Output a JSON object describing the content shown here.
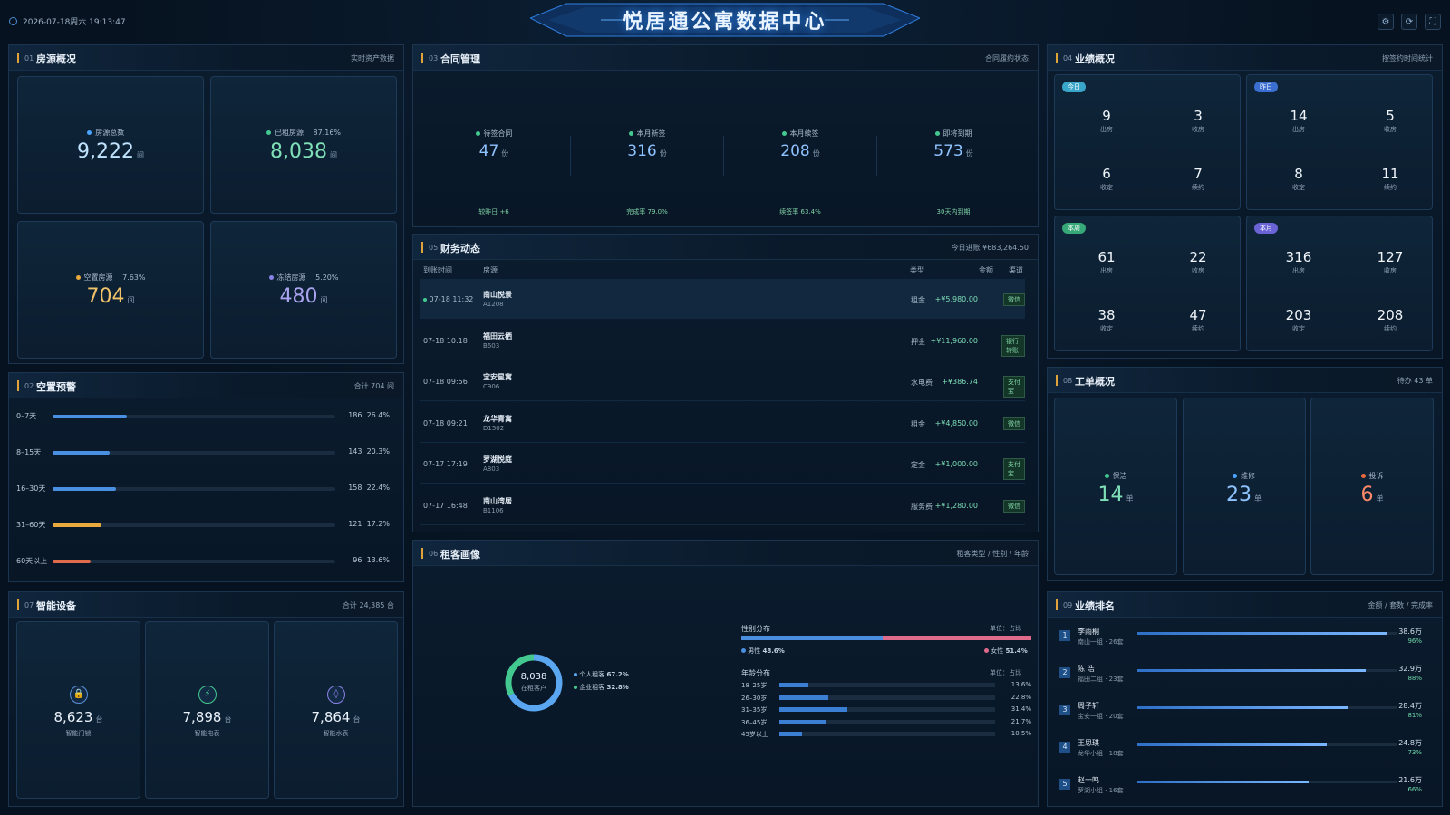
{
  "header": {
    "datetime": "2026-07-18周六 19:13:47",
    "title": "悦居通公寓数据中心",
    "buttons": [
      "settings-icon",
      "refresh-icon",
      "fullscreen-icon"
    ]
  },
  "p01": {
    "num": "01",
    "title": "房源概况",
    "meta": "实时资产数据",
    "cards": [
      {
        "label": "房源总数",
        "pct": "",
        "value": "9,222",
        "unit": "间",
        "color": "#bfe3ff",
        "dot": "#4aa3ff"
      },
      {
        "label": "已租房源",
        "pct": "87.16%",
        "value": "8,038",
        "unit": "间",
        "color": "#7fe0b8",
        "dot": "#43c98f"
      },
      {
        "label": "空置房源",
        "pct": "7.63%",
        "value": "704",
        "unit": "间",
        "color": "#f0c36a",
        "dot": "#e9a93c"
      },
      {
        "label": "冻结房源",
        "pct": "5.20%",
        "value": "480",
        "unit": "间",
        "color": "#a8a2ef",
        "dot": "#8a82e6"
      }
    ]
  },
  "p02": {
    "num": "02",
    "title": "空置预警",
    "meta": "合计 704 间",
    "rows": [
      {
        "label": "0–7天",
        "count": "186",
        "pct": "26.4%",
        "ratio": 0.264,
        "color": "#4a90e2"
      },
      {
        "label": "8–15天",
        "count": "143",
        "pct": "20.3%",
        "ratio": 0.203,
        "color": "#4a90e2"
      },
      {
        "label": "16–30天",
        "count": "158",
        "pct": "22.4%",
        "ratio": 0.224,
        "color": "#4a90e2"
      },
      {
        "label": "31–60天",
        "count": "121",
        "pct": "17.2%",
        "ratio": 0.172,
        "color": "#e9a93c"
      },
      {
        "label": "60天以上",
        "count": "96",
        "pct": "13.6%",
        "ratio": 0.136,
        "color": "#e06a4a"
      }
    ]
  },
  "p07": {
    "num": "07",
    "title": "智能设备",
    "meta": "合计 24,385 台",
    "cards": [
      {
        "icon": "lock-icon",
        "value": "8,623",
        "unit": "台",
        "label": "智能门锁",
        "color": "#5b8fd8"
      },
      {
        "icon": "bolt-icon",
        "value": "7,898",
        "unit": "台",
        "label": "智能电表",
        "color": "#43c98f"
      },
      {
        "icon": "drop-icon",
        "value": "7,864",
        "unit": "台",
        "label": "智能水表",
        "color": "#8a82e6"
      }
    ]
  },
  "p03": {
    "num": "03",
    "title": "合同管理",
    "meta": "合同履约状态",
    "stats": [
      {
        "label": "待签合同",
        "value": "47",
        "unit": "份",
        "foot": "较昨日 +6",
        "dot": "#43c98f"
      },
      {
        "label": "本月新签",
        "value": "316",
        "unit": "份",
        "foot": "完成率 79.0%",
        "dot": "#43c98f"
      },
      {
        "label": "本月续签",
        "value": "208",
        "unit": "份",
        "foot": "续签率 63.4%",
        "dot": "#43c98f"
      },
      {
        "label": "即将到期",
        "value": "573",
        "unit": "份",
        "foot": "30天内到期",
        "dot": "#43c98f"
      }
    ]
  },
  "p05": {
    "num": "05",
    "title": "财务动态",
    "meta": "今日进账 ¥683,264.50",
    "cols": [
      "到账时间",
      "房源",
      "类型",
      "金额",
      "渠道"
    ],
    "rows": [
      {
        "time": "07-18 11:32",
        "name": "南山悦景",
        "room": "A1208",
        "type": "租金",
        "amount": "+¥5,980.00",
        "channel": "微信"
      },
      {
        "time": "07-18 10:18",
        "name": "福田云栖",
        "room": "B603",
        "type": "押金",
        "amount": "+¥11,960.00",
        "channel": "银行转账"
      },
      {
        "time": "07-18 09:56",
        "name": "宝安星寓",
        "room": "C906",
        "type": "水电费",
        "amount": "+¥386.74",
        "channel": "支付宝"
      },
      {
        "time": "07-18 09:21",
        "name": "龙华青寓",
        "room": "D1502",
        "type": "租金",
        "amount": "+¥4,850.00",
        "channel": "微信"
      },
      {
        "time": "07-17 17:19",
        "name": "罗湖悦庭",
        "room": "A803",
        "type": "定金",
        "amount": "+¥1,000.00",
        "channel": "支付宝"
      },
      {
        "time": "07-17 16:48",
        "name": "南山湾居",
        "room": "B1106",
        "type": "服务费",
        "amount": "+¥1,280.00",
        "channel": "微信"
      }
    ]
  },
  "p06": {
    "num": "06",
    "title": "租客画像",
    "meta": "租客类型 / 性别 / 年龄",
    "donut": {
      "value": "8,038",
      "label": "在租客户",
      "items": [
        {
          "label": "个人租客",
          "pct": "67.2%",
          "ratio": 0.672,
          "color": "#5aa6f0"
        },
        {
          "label": "企业租客",
          "pct": "32.8%",
          "ratio": 0.328,
          "color": "#43c98f"
        }
      ]
    },
    "gender": {
      "title": "性别分布",
      "unit": "单位：占比",
      "male": "男性",
      "male_pct": "48.6%",
      "male_ratio": 0.486,
      "female": "女性",
      "female_pct": "51.4%"
    },
    "age": {
      "title": "年龄分布",
      "unit": "单位：占比",
      "rows": [
        {
          "label": "18–25岁",
          "pct": "13.6%",
          "ratio": 0.136
        },
        {
          "label": "26–30岁",
          "pct": "22.8%",
          "ratio": 0.228
        },
        {
          "label": "31–35岁",
          "pct": "31.4%",
          "ratio": 0.314
        },
        {
          "label": "36–45岁",
          "pct": "21.7%",
          "ratio": 0.217
        },
        {
          "label": "45岁以上",
          "pct": "10.5%",
          "ratio": 0.105
        }
      ]
    }
  },
  "p04": {
    "num": "04",
    "title": "业绩概况",
    "meta": "按签约时间统计",
    "blocks": [
      {
        "badge": "今日",
        "badge_color": "#3aa6c9",
        "vals": [
          "9",
          "3",
          "6",
          "7"
        ]
      },
      {
        "badge": "昨日",
        "badge_color": "#3a6fd1",
        "vals": [
          "14",
          "5",
          "8",
          "11"
        ]
      },
      {
        "badge": "本周",
        "badge_color": "#37a878",
        "vals": [
          "61",
          "22",
          "38",
          "47"
        ]
      },
      {
        "badge": "本月",
        "badge_color": "#6a63d6",
        "vals": [
          "316",
          "127",
          "203",
          "208"
        ]
      }
    ],
    "labels": [
      "出房",
      "收房",
      "收定",
      "续约"
    ]
  },
  "p08": {
    "num": "08",
    "title": "工单概况",
    "meta": "待办 43 单",
    "cards": [
      {
        "label": "保洁",
        "value": "14",
        "unit": "单",
        "color": "#7fe0b8",
        "dot": "#43c98f"
      },
      {
        "label": "维修",
        "value": "23",
        "unit": "单",
        "color": "#8fc3ff",
        "dot": "#4aa3ff"
      },
      {
        "label": "投诉",
        "value": "6",
        "unit": "单",
        "color": "#ff8a6a",
        "dot": "#e9693c"
      }
    ]
  },
  "p09": {
    "num": "09",
    "title": "业绩排名",
    "meta": "金额 / 套数 / 完成率",
    "rows": [
      {
        "rank": "1",
        "name": "李雨桐",
        "sub": "南山一组 · 26套",
        "amount": "38.6万",
        "pct": "96%",
        "ratio": 0.96
      },
      {
        "rank": "2",
        "name": "陈 浩",
        "sub": "福田二组 · 23套",
        "amount": "32.9万",
        "pct": "88%",
        "ratio": 0.88
      },
      {
        "rank": "3",
        "name": "周子轩",
        "sub": "宝安一组 · 20套",
        "amount": "28.4万",
        "pct": "81%",
        "ratio": 0.81
      },
      {
        "rank": "4",
        "name": "王思琪",
        "sub": "龙华小组 · 18套",
        "amount": "24.8万",
        "pct": "73%",
        "ratio": 0.73
      },
      {
        "rank": "5",
        "name": "赵一鸣",
        "sub": "罗湖小组 · 16套",
        "amount": "21.6万",
        "pct": "66%",
        "ratio": 0.66
      }
    ]
  }
}
